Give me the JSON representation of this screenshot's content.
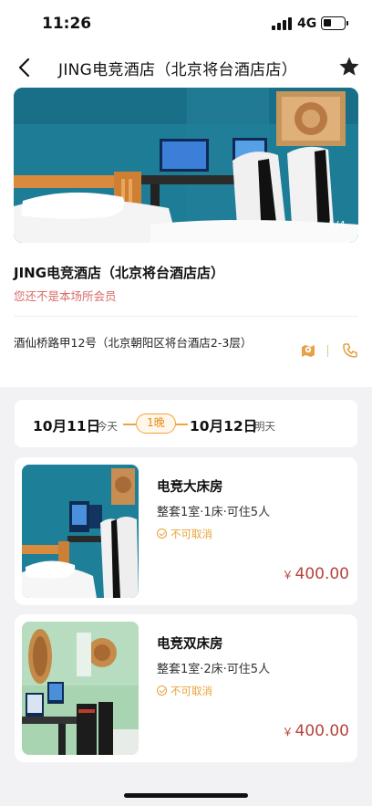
{
  "status_bar": {
    "time": "11:26",
    "network": "4G"
  },
  "nav": {
    "title": "JING电竞酒店（北京将台酒店店）"
  },
  "hotel": {
    "photo_counter": "1/4",
    "name": "JING电竞酒店（北京将台酒店店）",
    "member_note": "您还不是本场所会员",
    "address": "酒仙桥路甲12号（北京朝阳区将台酒店2-3层）",
    "icons": [
      "map-icon",
      "phone-icon"
    ]
  },
  "dates": {
    "check_in": "10月11日",
    "check_in_tag": "今天",
    "nights": "1晚",
    "check_out": "10月12日",
    "check_out_tag": "明天"
  },
  "rooms": [
    {
      "name": "电竞大床房",
      "spec": "整套1室·1床·可住5人",
      "cancel": "不可取消",
      "currency": "￥",
      "price": "400.00"
    },
    {
      "name": "电竞双床房",
      "spec": "整套1室·2床·可住5人",
      "cancel": "不可取消",
      "currency": "￥",
      "price": "400.00"
    }
  ],
  "colors": {
    "accent": "#f0a23c",
    "price": "#b5433b",
    "member_note": "#d86a6a",
    "background": "#f2f2f4"
  }
}
